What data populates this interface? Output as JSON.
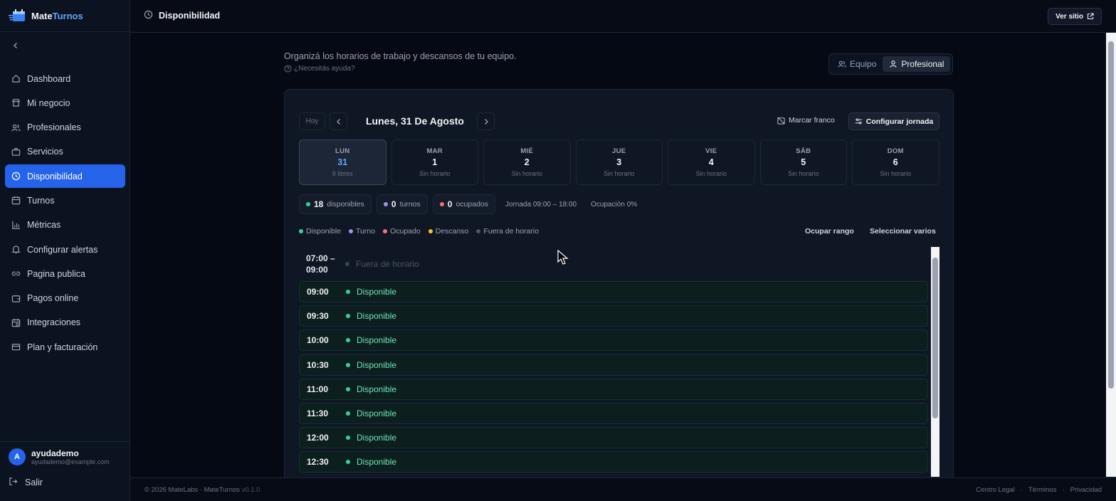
{
  "brand": {
    "name_a": "Mate",
    "name_b": "Turnos"
  },
  "sidebar": {
    "items": [
      {
        "label": "Dashboard",
        "icon": "home-icon"
      },
      {
        "label": "Mi negocio",
        "icon": "store-icon"
      },
      {
        "label": "Profesionales",
        "icon": "users-icon"
      },
      {
        "label": "Servicios",
        "icon": "briefcase-icon"
      },
      {
        "label": "Disponibilidad",
        "icon": "clock-icon",
        "active": true
      },
      {
        "label": "Turnos",
        "icon": "calendar-icon"
      },
      {
        "label": "Métricas",
        "icon": "bar-chart-icon"
      },
      {
        "label": "Configurar alertas",
        "icon": "bell-icon"
      },
      {
        "label": "Pagina publica",
        "icon": "link-icon"
      },
      {
        "label": "Pagos online",
        "icon": "wallet-icon"
      },
      {
        "label": "Integraciones",
        "icon": "calendar-sync-icon"
      },
      {
        "label": "Plan y facturación",
        "icon": "credit-card-icon"
      }
    ],
    "user": {
      "initial": "A",
      "name": "ayudademo",
      "email": "ayudademo@example.com"
    },
    "logout": "Salir"
  },
  "header": {
    "title": "Disponibilidad",
    "ver_sitio": "Ver sitio"
  },
  "intro": {
    "text": "Organizá los horarios de trabajo y descansos de tu equipo.",
    "help": "¿Necesitás ayuda?"
  },
  "view_toggle": {
    "equipo": "Equipo",
    "profesional": "Profesional",
    "selected": "Profesional"
  },
  "toolbar": {
    "hoy": "Hoy",
    "date_title": "Lunes, 31 De Agosto",
    "marcar_franco": "Marcar franco",
    "configurar_jornada": "Configurar jornada"
  },
  "days": [
    {
      "name": "LUN",
      "num": "31",
      "status": "9 libres"
    },
    {
      "name": "MAR",
      "num": "1",
      "status": "Sin horario"
    },
    {
      "name": "MIÉ",
      "num": "2",
      "status": "Sin horario"
    },
    {
      "name": "JUE",
      "num": "3",
      "status": "Sin horario"
    },
    {
      "name": "VIE",
      "num": "4",
      "status": "Sin horario"
    },
    {
      "name": "SÁB",
      "num": "5",
      "status": "Sin horario"
    },
    {
      "name": "DOM",
      "num": "6",
      "status": "Sin horario"
    }
  ],
  "stats": {
    "disponibles": {
      "count": "18",
      "label": "disponibles"
    },
    "turnos": {
      "count": "0",
      "label": "turnos"
    },
    "ocupados": {
      "count": "0",
      "label": "ocupados"
    },
    "jornada": "Jornada 09:00 – 18:00",
    "ocupacion": "Ocupación 0%"
  },
  "legend": [
    {
      "label": "Disponible",
      "color": "#34d399"
    },
    {
      "label": "Turno",
      "color": "#a78bfa"
    },
    {
      "label": "Ocupado",
      "color": "#f87171"
    },
    {
      "label": "Descanso",
      "color": "#fbbf24"
    },
    {
      "label": "Fuera de horario",
      "color": "#4b5563"
    }
  ],
  "actions": {
    "ocupar_rango": "Ocupar rango",
    "seleccionar_varios": "Seleccionar varios"
  },
  "off_slot": {
    "time_a": "07:00 –",
    "time_b": "09:00",
    "label": "Fuera de horario"
  },
  "slots": [
    {
      "time": "09:00",
      "label": "Disponible"
    },
    {
      "time": "09:30",
      "label": "Disponible"
    },
    {
      "time": "10:00",
      "label": "Disponible"
    },
    {
      "time": "10:30",
      "label": "Disponible"
    },
    {
      "time": "11:00",
      "label": "Disponible"
    },
    {
      "time": "11:30",
      "label": "Disponible"
    },
    {
      "time": "12:00",
      "label": "Disponible"
    },
    {
      "time": "12:30",
      "label": "Disponible"
    }
  ],
  "footer": {
    "copyright": "© 2026 MateLabs · MateTurnos",
    "version": "v0.1.0",
    "links": [
      "Centro Legal",
      "·",
      "Términos",
      "·",
      "Privacidad"
    ]
  }
}
